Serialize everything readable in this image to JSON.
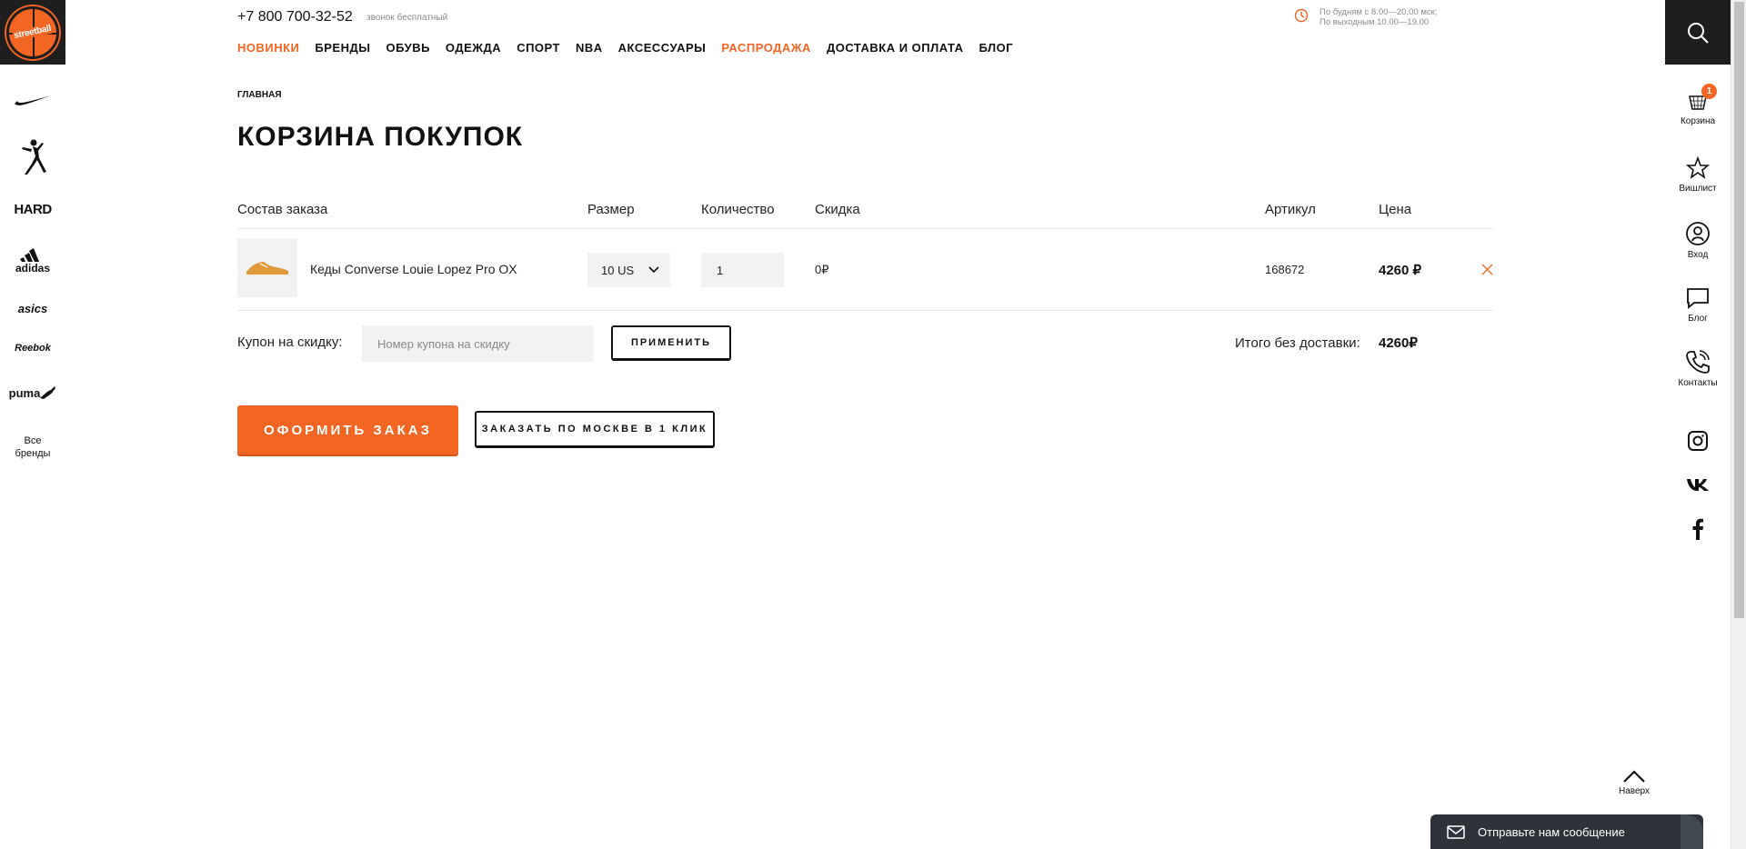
{
  "header": {
    "phone": "+7 800 700-32-52",
    "phone_note": "звонок бесплатный",
    "hours_line1": "По будням с 8.00—20.00 мск;",
    "hours_line2": "По выходным 10.00—19.00"
  },
  "nav": [
    {
      "label": "НОВИНКИ",
      "accent": true
    },
    {
      "label": "БРЕНДЫ"
    },
    {
      "label": "ОБУВЬ"
    },
    {
      "label": "ОДЕЖДА"
    },
    {
      "label": "СПОРТ"
    },
    {
      "label": "NBA"
    },
    {
      "label": "АКСЕССУАРЫ"
    },
    {
      "label": "РАСПРОДАЖА",
      "accent": true
    },
    {
      "label": "ДОСТАВКА И ОПЛАТА"
    },
    {
      "label": "БЛОГ"
    }
  ],
  "logo_text": "streetball",
  "brands": {
    "hard": "HARD",
    "adidas": "adidas",
    "asics": "asics",
    "reebok": "Reebok",
    "puma": "puma",
    "all_line1": "Все",
    "all_line2": "бренды"
  },
  "breadcrumb": "ГЛАВНАЯ",
  "page_title": "КОРЗИНА ПОКУПОК",
  "table": {
    "col_item": "Состав заказа",
    "col_size": "Размер",
    "col_qty": "Количество",
    "col_discount": "Скидка",
    "col_sku": "Артикул",
    "col_price": "Цена"
  },
  "cart_item": {
    "name": "Кеды Converse Louie Lopez Pro OX",
    "size": "10 US",
    "quantity": "1",
    "discount": "0₽",
    "sku": "168672",
    "price": "4260 ₽"
  },
  "coupon": {
    "label": "Купон на скидку:",
    "placeholder": "Номер купона на скидку",
    "apply": "ПРИМЕНИТЬ"
  },
  "total": {
    "label": "Итого без доставки:",
    "value": "4260₽"
  },
  "actions": {
    "checkout": "ОФОРМИТЬ ЗАКАЗ",
    "one_click": "ЗАКАЗАТЬ ПО МОСКВЕ В 1 КЛИК"
  },
  "right_bar": {
    "cart": "Корзина",
    "cart_count": "1",
    "wishlist": "Вишлист",
    "login": "Вход",
    "blog": "Блог",
    "contacts": "Контакты"
  },
  "to_top": "Наверх",
  "chat": "Отправьте нам сообщение",
  "colors": {
    "accent": "#f26522",
    "dark": "#1e1e1e"
  }
}
